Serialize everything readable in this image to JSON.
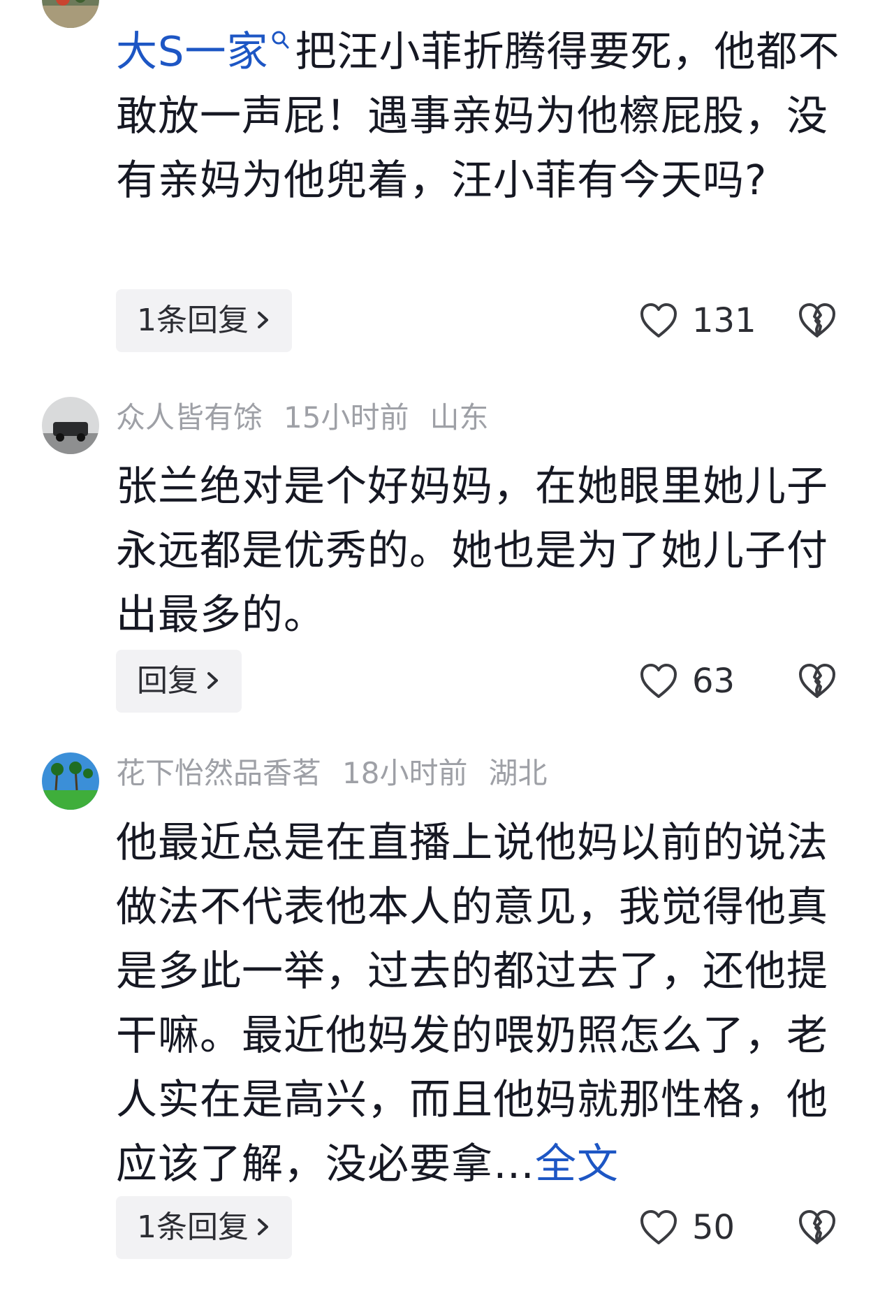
{
  "comments": [
    {
      "mention": "大S一家",
      "text": "把汪小菲折腾得要死，他都不敢放一声屁！遇事亲妈为他檫屁股，没有亲妈为他兜着，汪小菲有今天吗?",
      "reply_label": "1条回复",
      "likes": "131"
    },
    {
      "username": "众人皆有馀",
      "time": "15小时前",
      "location": "山东",
      "text": "张兰绝对是个好妈妈，在她眼里她儿子永远都是优秀的。她也是为了她儿子付出最多的。",
      "reply_label": "回复",
      "likes": "63"
    },
    {
      "username": "花下怡然品香茗",
      "time": "18小时前",
      "location": "湖北",
      "text": "他最近总是在直播上说他妈以前的说法做法不代表他本人的意见，我觉得他真是多此一举，过去的都过去了，还他提干嘛。最近他妈发的喂奶照怎么了，老人实在是高兴，而且他妈就那性格，他应该了解，没必要拿…",
      "more_label": "全文",
      "reply_label": "1条回复",
      "likes": "50"
    }
  ],
  "icons": {
    "like": "heart-outline-icon",
    "dislike": "broken-heart-icon",
    "chevron": "chevron-right-icon",
    "mention": "search-icon"
  },
  "colors": {
    "link": "#1d56c4",
    "meta": "#9ea0a6",
    "text": "#161823",
    "pill_bg": "#f2f2f4"
  }
}
